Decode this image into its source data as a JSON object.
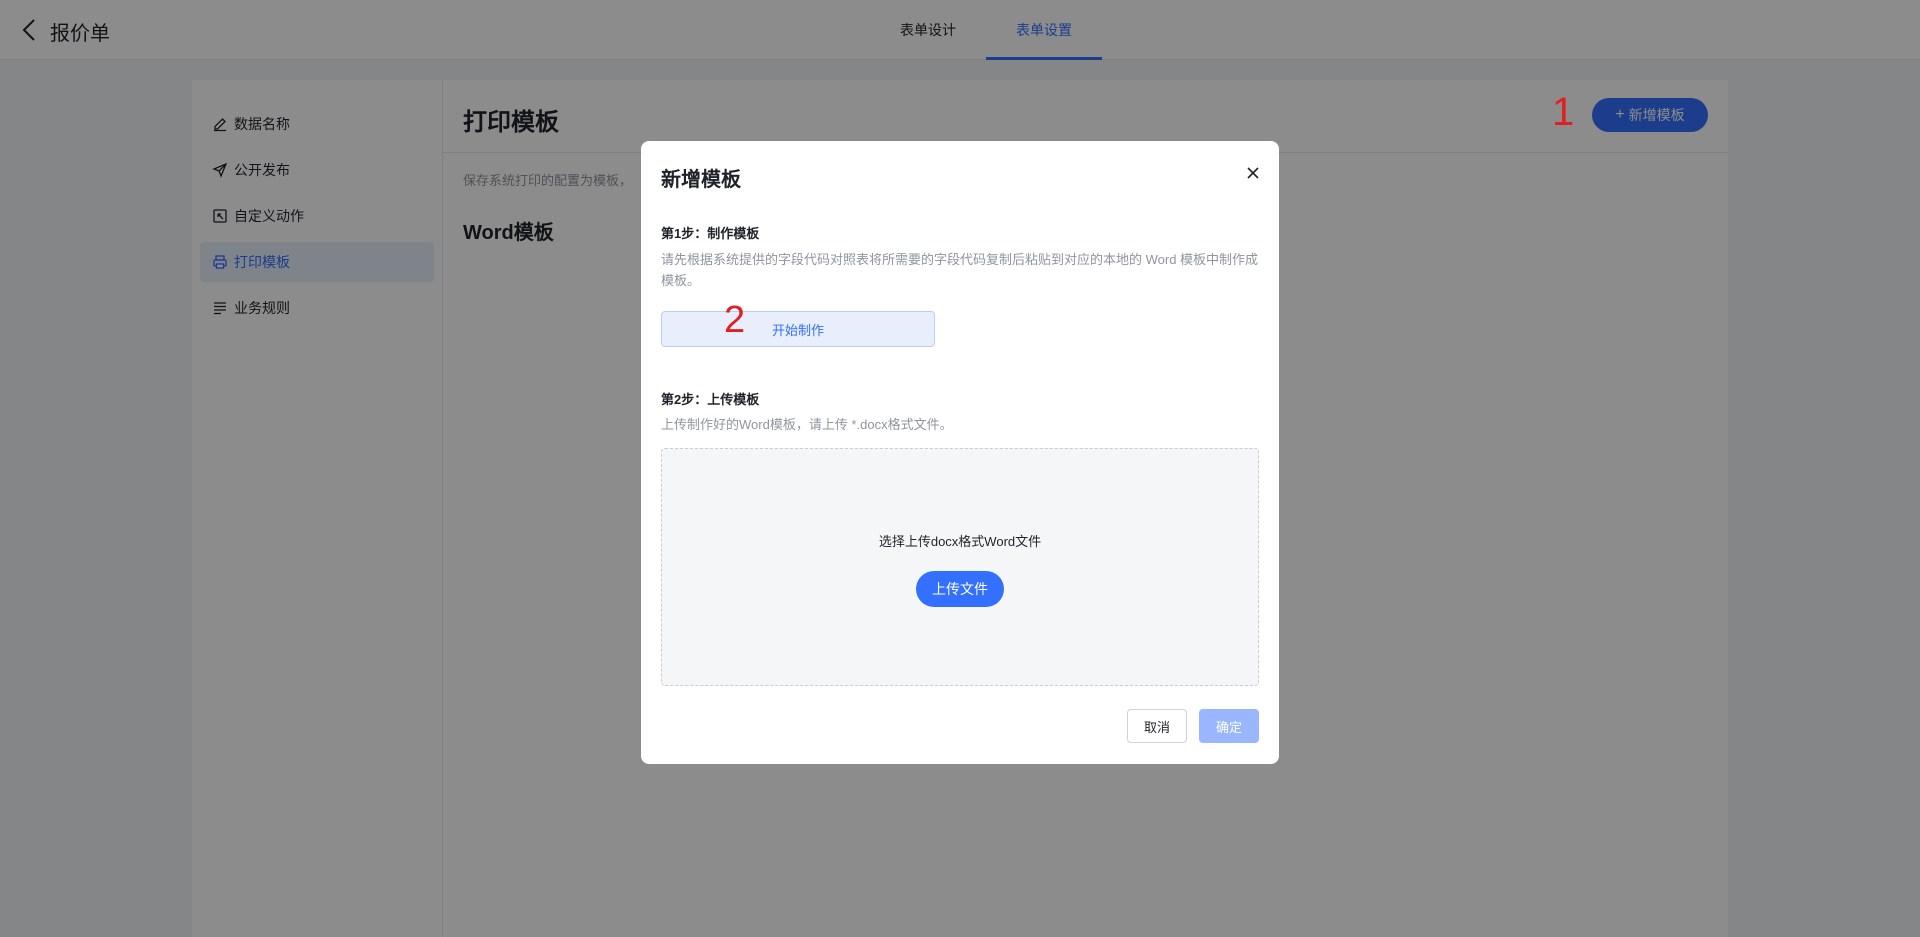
{
  "header": {
    "title": "报价单",
    "tabs": [
      {
        "label": "表单设计",
        "active": false
      },
      {
        "label": "表单设置",
        "active": true
      }
    ]
  },
  "sidebar": {
    "items": [
      {
        "label": "数据名称",
        "icon": "edit-icon",
        "active": false
      },
      {
        "label": "公开发布",
        "icon": "send-icon",
        "active": false
      },
      {
        "label": "自定义动作",
        "icon": "custom-action-icon",
        "active": false
      },
      {
        "label": "打印模板",
        "icon": "printer-icon",
        "active": true
      },
      {
        "label": "业务规则",
        "icon": "list-icon",
        "active": false
      }
    ]
  },
  "main": {
    "title": "打印模板",
    "description": "保存系统打印的配置为模板，",
    "section_title": "Word模板",
    "add_button": "新增模板"
  },
  "annotations": {
    "marker_1": "1",
    "marker_2": "2"
  },
  "modal": {
    "title": "新增模板",
    "step1": {
      "title": "第1步：制作模板",
      "desc": "请先根据系统提供的字段代码对照表将所需要的字段代码复制后粘贴到对应的本地的 Word 模板中制作成模板。",
      "button": "开始制作"
    },
    "step2": {
      "title": "第2步：上传模板",
      "desc": "上传制作好的Word模板，请上传 *.docx格式文件。",
      "dropzone_text": "选择上传docx格式Word文件",
      "upload_button": "上传文件"
    },
    "cancel": "取消",
    "confirm": "确定"
  },
  "colors": {
    "accent": "#3370ff",
    "overlay": "rgba(0,0,0,0.45)",
    "marker": "#e02020"
  }
}
